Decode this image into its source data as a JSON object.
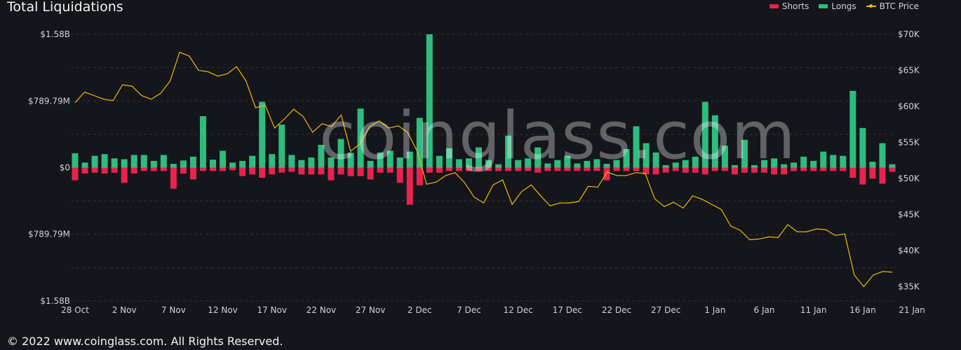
{
  "title": "Total Liquidations",
  "legend": [
    {
      "label": "Shorts",
      "color": "#e8234e"
    },
    {
      "label": "Longs",
      "color": "#2ebd7f"
    },
    {
      "label": "BTC Price",
      "color": "#f0b90b"
    }
  ],
  "watermark": "coinglass.com",
  "footer": "© 2022 www.coinglass.com. All Rights Reserved.",
  "chart_data": {
    "type": "bar",
    "title": "Total Liquidations",
    "y_left_ticks": [
      "$1.58B",
      "$789.79M",
      "$0",
      "$789.79M",
      "$1.58B"
    ],
    "y_left_values": [
      1580,
      789.79,
      0,
      -789.79,
      -1580
    ],
    "y_left_range": [
      -1580,
      1580
    ],
    "y_right_ticks": [
      "$70K",
      "$65K",
      "$60K",
      "$55K",
      "$50K",
      "$45K",
      "$40K",
      "$35K"
    ],
    "y_right_values": [
      70000,
      65000,
      60000,
      55000,
      50000,
      45000,
      40000,
      35000
    ],
    "y_right_range": [
      33000,
      70000
    ],
    "x_ticks": [
      "28 Oct",
      "2 Nov",
      "7 Nov",
      "12 Nov",
      "17 Nov",
      "22 Nov",
      "27 Nov",
      "2 Dec",
      "7 Dec",
      "12 Dec",
      "17 Dec",
      "22 Dec",
      "27 Dec",
      "1 Jan",
      "6 Jan",
      "11 Jan",
      "16 Jan",
      "21 Jan"
    ],
    "x_tick_index": [
      0,
      5,
      10,
      15,
      20,
      25,
      30,
      35,
      40,
      45,
      50,
      55,
      60,
      65,
      70,
      75,
      80,
      85
    ],
    "grid": true,
    "legend_position": "top-right",
    "series": [
      {
        "name": "Longs",
        "unit": "$M",
        "values": [
          170,
          60,
          140,
          160,
          110,
          100,
          150,
          150,
          80,
          150,
          45,
          85,
          130,
          610,
          95,
          200,
          60,
          80,
          140,
          780,
          160,
          510,
          150,
          90,
          120,
          270,
          120,
          340,
          175,
          700,
          80,
          180,
          200,
          120,
          190,
          590,
          1580,
          140,
          230,
          100,
          110,
          240,
          90,
          40,
          380,
          90,
          110,
          240,
          50,
          90,
          140,
          50,
          80,
          100,
          45,
          90,
          220,
          490,
          290,
          180,
          30,
          60,
          90,
          130,
          780,
          620,
          260,
          30,
          330,
          30,
          90,
          110,
          40,
          60,
          130,
          80,
          190,
          150,
          140,
          910,
          470,
          70,
          290,
          40
        ]
      },
      {
        "name": "Shorts",
        "unit": "$M",
        "values": [
          -150,
          -70,
          -60,
          -70,
          -60,
          -180,
          -70,
          -40,
          -40,
          -40,
          -250,
          -70,
          -140,
          -40,
          -40,
          -40,
          -30,
          -100,
          -80,
          -120,
          -80,
          -60,
          -50,
          -80,
          -80,
          -80,
          -150,
          -80,
          -100,
          -100,
          -140,
          -60,
          -60,
          -180,
          -440,
          -210,
          -60,
          -60,
          -40,
          -40,
          -40,
          -40,
          -40,
          -40,
          -40,
          -40,
          -40,
          -60,
          -40,
          -40,
          -40,
          -40,
          -40,
          -40,
          -150,
          -40,
          -40,
          -40,
          -80,
          -80,
          -60,
          -40,
          -60,
          -60,
          -80,
          -40,
          -40,
          -80,
          -60,
          -60,
          -60,
          -80,
          -80,
          -40,
          -40,
          -40,
          -40,
          -40,
          -40,
          -120,
          -200,
          -130,
          -190,
          -50
        ]
      },
      {
        "name": "BTC Price",
        "unit": "USD",
        "values": [
          60500,
          62000,
          61500,
          61000,
          60800,
          63000,
          62800,
          61500,
          61000,
          61800,
          63500,
          67500,
          67000,
          65000,
          64800,
          64200,
          64500,
          65500,
          63500,
          59800,
          60200,
          57000,
          58200,
          59600,
          58600,
          56400,
          57600,
          57200,
          58800,
          53800,
          54800,
          57200,
          58000,
          57000,
          57300,
          56400,
          53800,
          49200,
          49500,
          50400,
          50800,
          49400,
          47400,
          46600,
          49100,
          49800,
          46400,
          48200,
          49100,
          47600,
          46200,
          46600,
          46600,
          46800,
          48900,
          48800,
          50900,
          50400,
          50400,
          50800,
          50700,
          47200,
          46100,
          46700,
          45900,
          47600,
          47100,
          46400,
          45700,
          43400,
          42800,
          41500,
          41600,
          41900,
          41800,
          43600,
          42600,
          42600,
          43000,
          42900,
          42100,
          42300,
          36600,
          35000,
          36600,
          37100,
          37000
        ]
      }
    ]
  }
}
